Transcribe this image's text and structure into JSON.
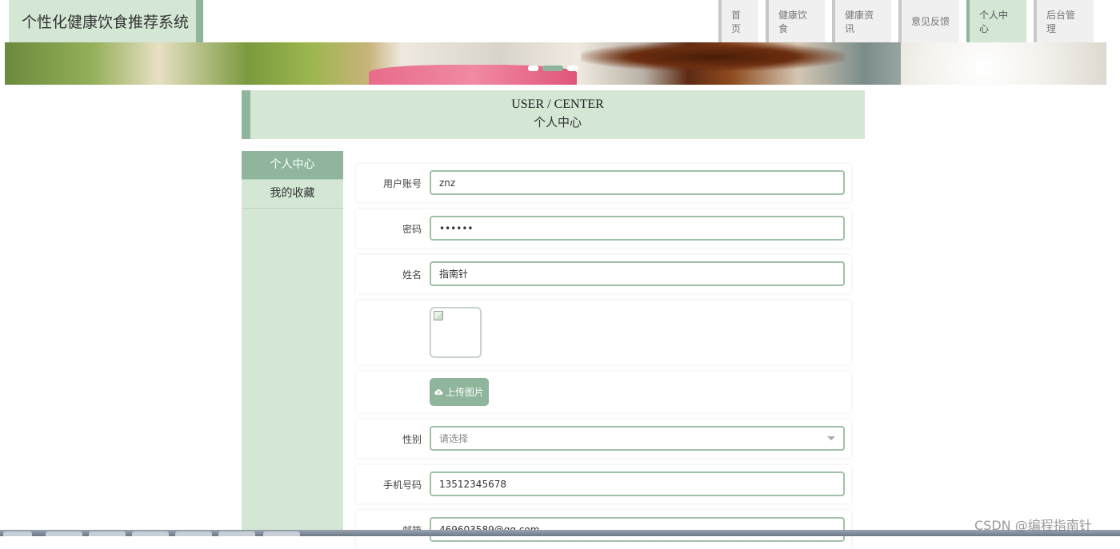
{
  "header": {
    "brand": "个性化健康饮食推荐系统",
    "nav": [
      {
        "label": "首页",
        "active": false
      },
      {
        "label": "健康饮食",
        "active": false
      },
      {
        "label": "健康资讯",
        "active": false
      },
      {
        "label": "意见反馈",
        "active": false
      },
      {
        "label": "个人中心",
        "active": true
      },
      {
        "label": "后台管理",
        "active": false
      }
    ]
  },
  "banner": {
    "slide_count": 3,
    "active_slide": 2
  },
  "page_title": {
    "en": "USER / CENTER",
    "zh": "个人中心"
  },
  "sidebar": {
    "items": [
      {
        "label": "个人中心",
        "active": true
      },
      {
        "label": "我的收藏",
        "active": false
      }
    ]
  },
  "form": {
    "username": {
      "label": "用户账号",
      "value": "znz"
    },
    "password": {
      "label": "密码",
      "value": "••••••"
    },
    "name": {
      "label": "姓名",
      "value": "指南针"
    },
    "upload_label": "上传图片",
    "gender": {
      "label": "性别",
      "placeholder": "请选择"
    },
    "phone": {
      "label": "手机号码",
      "value": "13512345678"
    },
    "email": {
      "label": "邮箱",
      "value": "469603589@qq.com"
    }
  },
  "watermark": "CSDN @编程指南针",
  "colors": {
    "accent": "#8fb69c",
    "accent_light": "#d3e7d4"
  }
}
